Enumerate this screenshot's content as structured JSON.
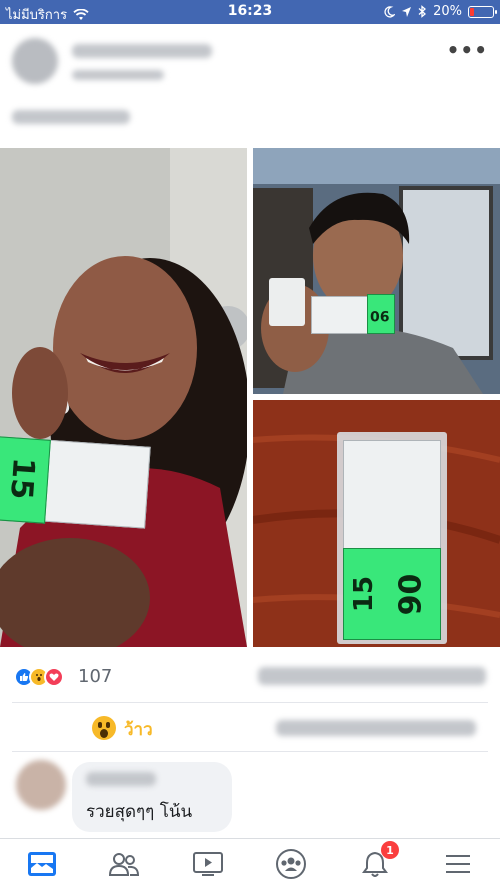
{
  "status_bar": {
    "carrier": "ไม่มีบริการ",
    "time": "16:23",
    "battery_percent": "20%",
    "battery_level": 0.2,
    "icons": [
      "wifi-icon",
      "moon-icon",
      "location-arrow-icon",
      "bluetooth-icon",
      "battery-icon"
    ]
  },
  "post": {
    "more_label": "•••",
    "ticket_left_number": "15",
    "ticket_tr_number": "90",
    "ticket_br_left": "15",
    "ticket_br_right": "90"
  },
  "reactions": {
    "count": "107",
    "types": [
      "like-icon",
      "wow-icon",
      "love-icon"
    ]
  },
  "wow_action": {
    "label": "ว้าว"
  },
  "comment": {
    "text": "รวยสุดๆๆ โน้น"
  },
  "tab_bar": {
    "tabs": [
      "news-feed-tab",
      "friends-tab",
      "watch-tab",
      "groups-tab",
      "notifications-tab",
      "menu-tab"
    ],
    "notification_badge": "1"
  },
  "colors": {
    "brand": "#4267b2",
    "active_tab": "#1877f2",
    "wow": "#f7b928",
    "badge": "#fa3e3e"
  }
}
